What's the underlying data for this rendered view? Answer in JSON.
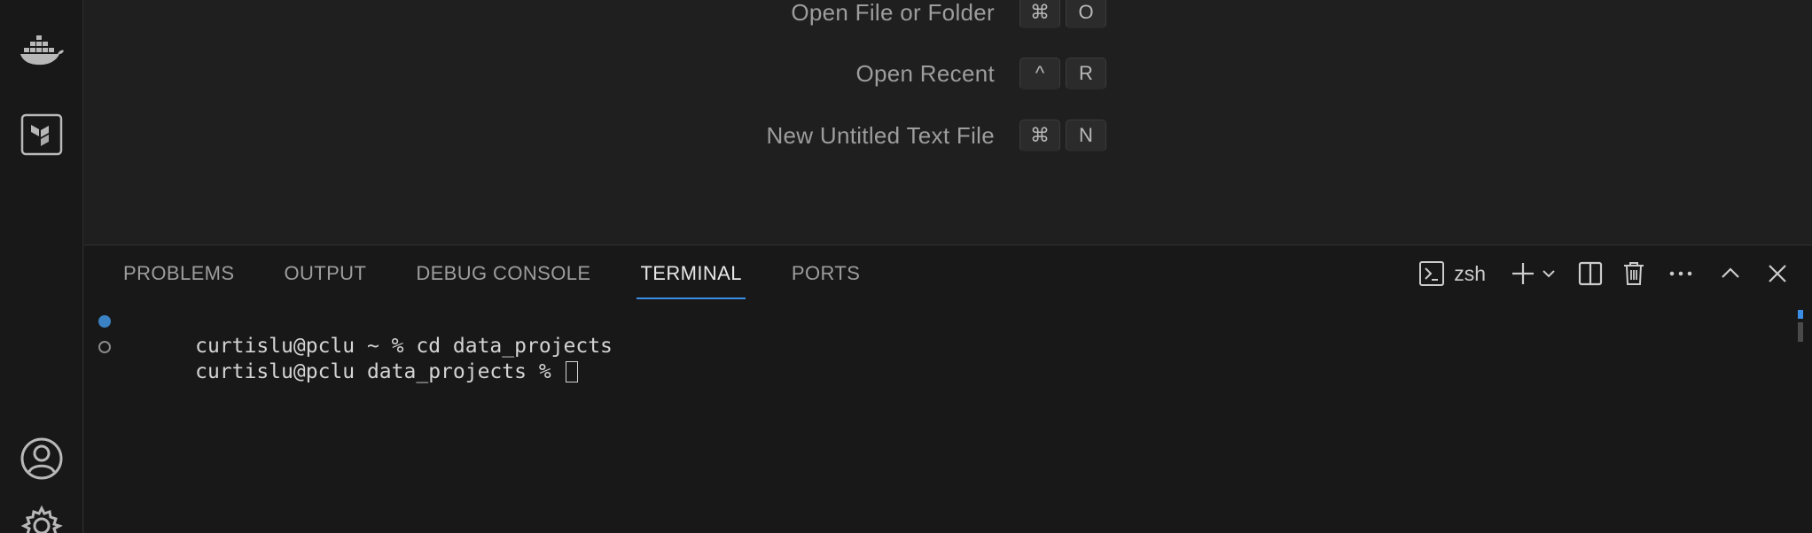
{
  "activity_bar": {
    "items": [
      {
        "name": "docker-icon"
      },
      {
        "name": "terraform-icon"
      },
      {
        "name": "account-icon"
      },
      {
        "name": "settings-gear-icon"
      }
    ]
  },
  "welcome": {
    "shortcuts": [
      {
        "label": "Open File or Folder",
        "keys": [
          "⌘",
          "O"
        ]
      },
      {
        "label": "Open Recent",
        "keys": [
          "^",
          "R"
        ]
      },
      {
        "label": "New Untitled Text File",
        "keys": [
          "⌘",
          "N"
        ]
      }
    ]
  },
  "panel": {
    "tabs": [
      {
        "label": "PROBLEMS",
        "active": false
      },
      {
        "label": "OUTPUT",
        "active": false
      },
      {
        "label": "DEBUG CONSOLE",
        "active": false
      },
      {
        "label": "TERMINAL",
        "active": true
      },
      {
        "label": "PORTS",
        "active": false
      }
    ],
    "actions": {
      "shell_label": "zsh"
    },
    "accent_color": "#3b8ee8"
  },
  "terminal": {
    "lines": [
      {
        "text": "curtislu@pclu ~ % cd data_projects",
        "decoration": "success"
      },
      {
        "text": "curtislu@pclu data_projects % ",
        "decoration": "pending"
      }
    ]
  }
}
